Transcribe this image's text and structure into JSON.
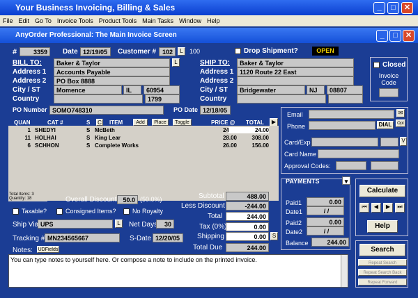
{
  "window": {
    "title": "Your Business Invoicing, Billing & Sales"
  },
  "menu": [
    "File",
    "Edit",
    "Go To",
    "Invoice Tools",
    "Product Tools",
    "Main Tasks",
    "Window",
    "Help"
  ],
  "inner_title": "AnyOrder Professional: The Main Invoice Screen",
  "header": {
    "num_label": "#",
    "num": "3359",
    "date_label": "Date",
    "date": "12/19/05",
    "customer_label": "Customer #",
    "customer": "102",
    "customer_btn": "L",
    "customer_ext": "100",
    "dropship_label": "Drop Shipment?",
    "status": "OPEN"
  },
  "bill": {
    "label": "BILL TO:",
    "btn": "L",
    "name": "Baker & Taylor",
    "addr1_label": "Address 1",
    "addr1": "Accounts Payable",
    "addr2_label": "Address 2",
    "addr2": "PO Box 8888",
    "city_label": "City / ST",
    "city": "Momence",
    "st": "IL",
    "zip": "60954",
    "zip2": "1799",
    "country_label": "Country"
  },
  "ship": {
    "label": "SHIP TO:",
    "btn": "L",
    "name": "Baker & Taylor",
    "addr1_label": "Address 1",
    "addr1": "1120 Route 22 East",
    "addr2_label": "Address 2",
    "city_label": "City / ST",
    "city": "Bridgewater",
    "st": "NJ",
    "zip": "08807",
    "country_label": "Country"
  },
  "closed": {
    "label": "Closed",
    "code_label": "Invoice Code"
  },
  "po": {
    "number_label": "PO Number",
    "number": "SOMO748310",
    "date_label": "PO Date",
    "date": "12/18/05"
  },
  "columns": {
    "quan": "QUAN",
    "cat": "CAT #",
    "s": "S",
    "c": "C",
    "item": "ITEM",
    "add": "Add",
    "place": "Place",
    "toggle": "Toggle",
    "price": "PRICE @",
    "total": "TOTAL"
  },
  "rows": [
    {
      "quan": "1",
      "cat": "SHEDYI",
      "s": "S",
      "item": "McBeth",
      "price": "24.00",
      "total": "24.00"
    },
    {
      "quan": "11",
      "cat": "HOLHAI",
      "s": "S",
      "item": "King Lear",
      "price": "28.00",
      "total": "308.00"
    },
    {
      "quan": "6",
      "cat": "SCHHON",
      "s": "S",
      "item": "Complete Works",
      "price": "26.00",
      "total": "156.00"
    }
  ],
  "totals_note": {
    "items": "Total Items: 3",
    "quantity": "Quantity: 18"
  },
  "discount": {
    "label": "Overall Discount",
    "value": "50.0",
    "pct": "(50.0%)"
  },
  "checks": {
    "taxable": "Taxable?",
    "consigned": "Consigned Items?",
    "noroyalty": "No Royalty"
  },
  "ship_via": {
    "label": "Ship Via",
    "value": "UPS",
    "btn": "L",
    "net_label": "Net Days",
    "net": "30"
  },
  "tracking": {
    "label": "Tracking #",
    "value": "MN234565667",
    "sdate_label": "S-Date",
    "sdate": "12/20/05"
  },
  "summary": {
    "subtotal_label": "Subtotal",
    "subtotal": "488.00",
    "less_label": "Less Discount",
    "less": "-244.00",
    "total_label": "Total",
    "total": "244.00",
    "tax_label": "Tax (0%)",
    "tax": "0.00",
    "shipping_label": "Shipping",
    "shipping": "0.00",
    "shipping_btn": "S",
    "due_label": "Total Due",
    "due": "244.00"
  },
  "notes": {
    "label": "Notes:",
    "btn": "UDFields",
    "text": "You can type notes to yourself here.  Or compose a note to include on the printed invoice."
  },
  "card": {
    "email_label": "Email",
    "phone_label": "Phone",
    "dial": "DIAL",
    "opt": "Opt",
    "exp_label": "Card/Exp",
    "v": "V",
    "name_label": "Card Name",
    "approval_label": "Approval Codes:"
  },
  "payments": {
    "label": "PAYMENTS",
    "paid1_label": "Paid1",
    "paid1": "0.00",
    "date1_label": "Date1",
    "date1": "/  /",
    "paid2_label": "Paid2",
    "paid2": "0.00",
    "date2_label": "Date2",
    "date2": "/  /",
    "balance_label": "Balance",
    "balance": "244.00"
  },
  "actions": {
    "calculate": "Calculate",
    "help": "Help",
    "search": "Search",
    "repeat_search": "Repeat Search",
    "repeat_back": "Repeat Search Back",
    "repeat_fwd": "Repeat Forward"
  },
  "colors": {
    "bg": "#1b3d94",
    "title": "#0a3fd0",
    "status": "#f0d000"
  }
}
